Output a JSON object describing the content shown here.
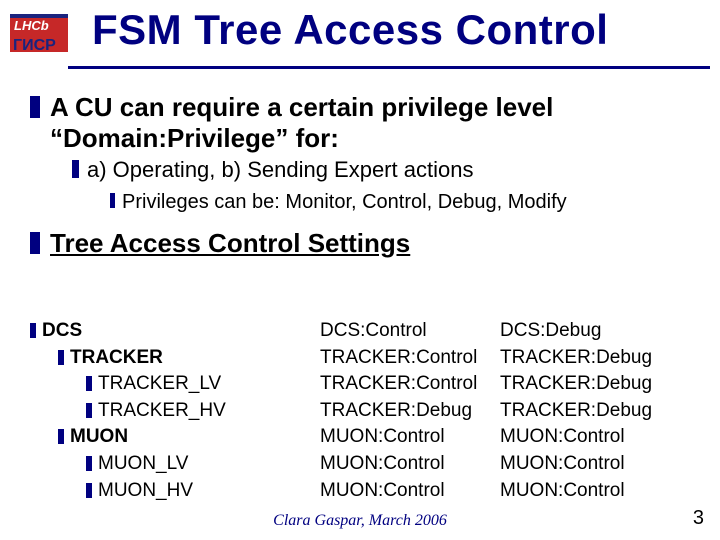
{
  "title": "FSM Tree Access Control",
  "bullet1_line1": "A CU can require a certain privilege level",
  "bullet1_line2": "“Domain:Privilege” for:",
  "bullet1_sub": "a) Operating, b) Sending Expert actions",
  "bullet1_subsub": "Privileges can be: Monitor, Control, Debug, Modify",
  "heading2": "Tree Access Control Settings",
  "tree": {
    "rows": [
      {
        "indent": 0,
        "label": "DCS",
        "col2": "DCS:Control",
        "col3": "DCS:Debug"
      },
      {
        "indent": 1,
        "label": "TRACKER",
        "col2": "TRACKER:Control",
        "col3": "TRACKER:Debug"
      },
      {
        "indent": 2,
        "label": "TRACKER_LV",
        "col2": "TRACKER:Control",
        "col3": "TRACKER:Debug"
      },
      {
        "indent": 2,
        "label": "TRACKER_HV",
        "col2": "TRACKER:Debug",
        "col3": "TRACKER:Debug"
      },
      {
        "indent": 1,
        "label": "MUON",
        "col2": "MUON:Control",
        "col3": "MUON:Control"
      },
      {
        "indent": 2,
        "label": "MUON_LV",
        "col2": "MUON:Control",
        "col3": "MUON:Control"
      },
      {
        "indent": 2,
        "label": "MUON_HV",
        "col2": "MUON:Control",
        "col3": "MUON:Control"
      }
    ]
  },
  "footer": "Clara Gaspar, March 2006",
  "page_number": "3"
}
